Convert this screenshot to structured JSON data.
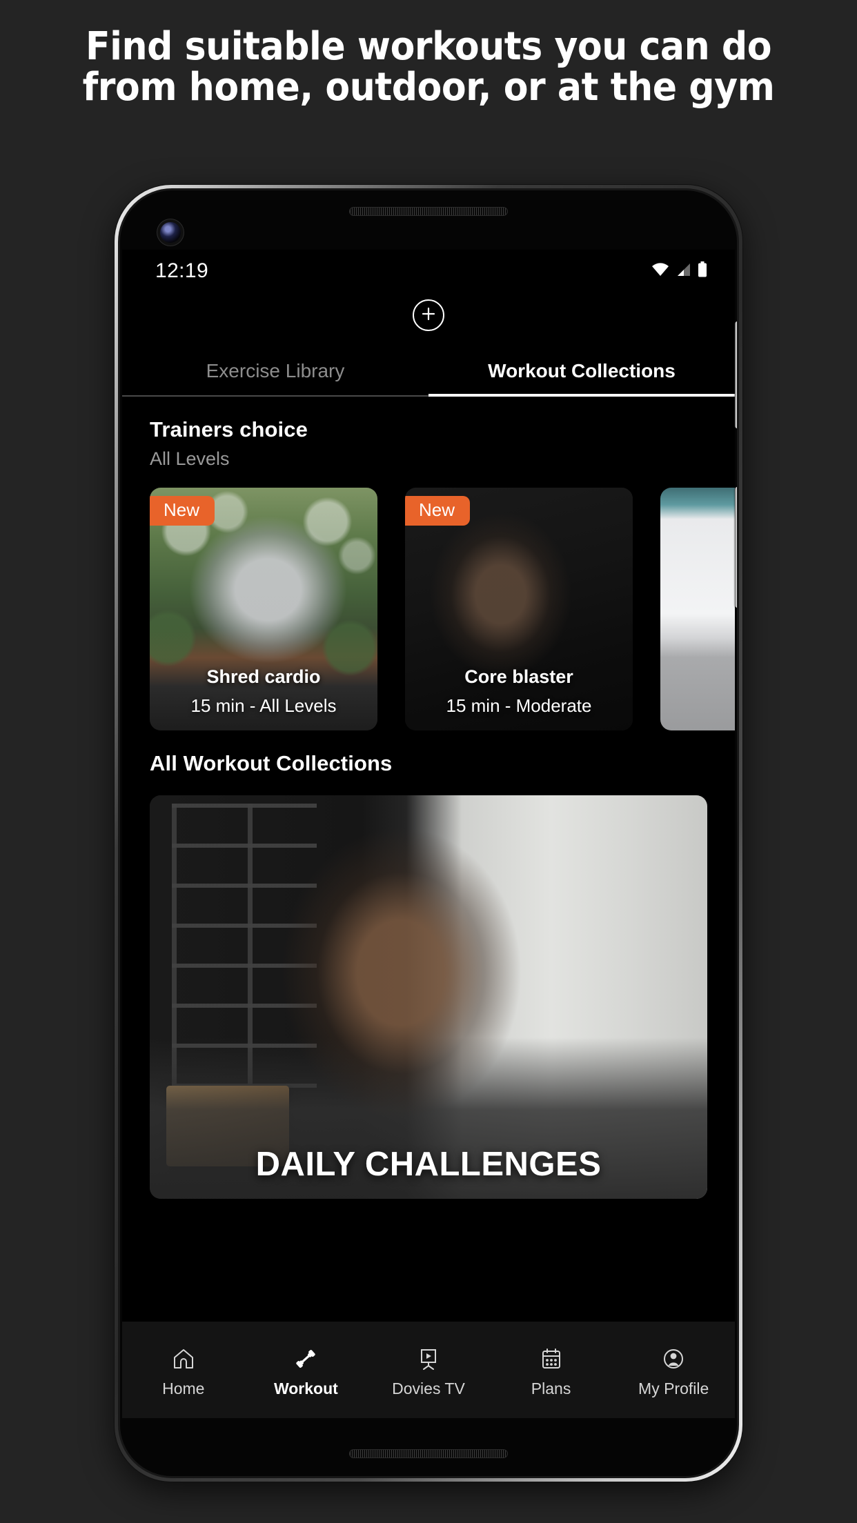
{
  "promo": {
    "line1": "Find suitable workouts you can do",
    "line2": "from home, outdoor, or at the gym"
  },
  "colors": {
    "page_background": "#242424",
    "screen_background": "#000000",
    "badge_orange": "#E8632A",
    "active_tab": "#ffffff",
    "inactive_tab": "#8d8d8d",
    "nav_background": "#141414"
  },
  "statusbar": {
    "time": "12:19",
    "icons": [
      "wifi-icon",
      "cellular-signal-icon",
      "battery-icon"
    ]
  },
  "header": {
    "add_icon": "plus-icon",
    "tabs": [
      {
        "label": "Exercise Library",
        "active": false
      },
      {
        "label": "Workout Collections",
        "active": true
      }
    ]
  },
  "trainers_choice": {
    "title": "Trainers choice",
    "subtitle": "All Levels",
    "cards": [
      {
        "badge": "New",
        "name": "Shred cardio",
        "duration": "15 min - All Levels",
        "photo": "outdoor"
      },
      {
        "badge": "New",
        "name": "Core blaster",
        "duration": "15 min - Moderate",
        "photo": "dark"
      },
      {
        "badge": "",
        "name": "",
        "duration": "",
        "photo": "light"
      }
    ]
  },
  "all_collections": {
    "title": "All Workout Collections",
    "cards": [
      {
        "title": "DAILY CHALLENGES",
        "photo": "gym"
      }
    ]
  },
  "bottom_nav": [
    {
      "label": "Home",
      "icon": "home-icon",
      "active": false
    },
    {
      "label": "Workout",
      "icon": "dumbbell-icon",
      "active": true
    },
    {
      "label": "Dovies TV",
      "icon": "tv-play-icon",
      "active": false
    },
    {
      "label": "Plans",
      "icon": "calendar-icon",
      "active": false
    },
    {
      "label": "My Profile",
      "icon": "person-icon",
      "active": false
    }
  ]
}
